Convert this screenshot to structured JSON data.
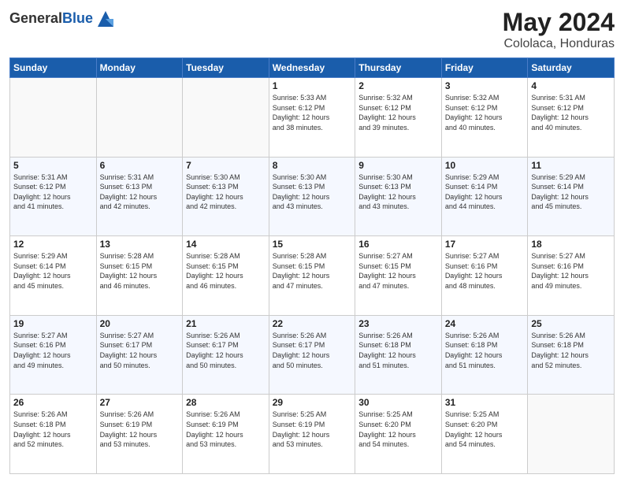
{
  "header": {
    "logo_general": "General",
    "logo_blue": "Blue",
    "month": "May 2024",
    "location": "Cololaca, Honduras"
  },
  "weekdays": [
    "Sunday",
    "Monday",
    "Tuesday",
    "Wednesday",
    "Thursday",
    "Friday",
    "Saturday"
  ],
  "weeks": [
    [
      {
        "day": "",
        "info": ""
      },
      {
        "day": "",
        "info": ""
      },
      {
        "day": "",
        "info": ""
      },
      {
        "day": "1",
        "info": "Sunrise: 5:33 AM\nSunset: 6:12 PM\nDaylight: 12 hours\nand 38 minutes."
      },
      {
        "day": "2",
        "info": "Sunrise: 5:32 AM\nSunset: 6:12 PM\nDaylight: 12 hours\nand 39 minutes."
      },
      {
        "day": "3",
        "info": "Sunrise: 5:32 AM\nSunset: 6:12 PM\nDaylight: 12 hours\nand 40 minutes."
      },
      {
        "day": "4",
        "info": "Sunrise: 5:31 AM\nSunset: 6:12 PM\nDaylight: 12 hours\nand 40 minutes."
      }
    ],
    [
      {
        "day": "5",
        "info": "Sunrise: 5:31 AM\nSunset: 6:12 PM\nDaylight: 12 hours\nand 41 minutes."
      },
      {
        "day": "6",
        "info": "Sunrise: 5:31 AM\nSunset: 6:13 PM\nDaylight: 12 hours\nand 42 minutes."
      },
      {
        "day": "7",
        "info": "Sunrise: 5:30 AM\nSunset: 6:13 PM\nDaylight: 12 hours\nand 42 minutes."
      },
      {
        "day": "8",
        "info": "Sunrise: 5:30 AM\nSunset: 6:13 PM\nDaylight: 12 hours\nand 43 minutes."
      },
      {
        "day": "9",
        "info": "Sunrise: 5:30 AM\nSunset: 6:13 PM\nDaylight: 12 hours\nand 43 minutes."
      },
      {
        "day": "10",
        "info": "Sunrise: 5:29 AM\nSunset: 6:14 PM\nDaylight: 12 hours\nand 44 minutes."
      },
      {
        "day": "11",
        "info": "Sunrise: 5:29 AM\nSunset: 6:14 PM\nDaylight: 12 hours\nand 45 minutes."
      }
    ],
    [
      {
        "day": "12",
        "info": "Sunrise: 5:29 AM\nSunset: 6:14 PM\nDaylight: 12 hours\nand 45 minutes."
      },
      {
        "day": "13",
        "info": "Sunrise: 5:28 AM\nSunset: 6:15 PM\nDaylight: 12 hours\nand 46 minutes."
      },
      {
        "day": "14",
        "info": "Sunrise: 5:28 AM\nSunset: 6:15 PM\nDaylight: 12 hours\nand 46 minutes."
      },
      {
        "day": "15",
        "info": "Sunrise: 5:28 AM\nSunset: 6:15 PM\nDaylight: 12 hours\nand 47 minutes."
      },
      {
        "day": "16",
        "info": "Sunrise: 5:27 AM\nSunset: 6:15 PM\nDaylight: 12 hours\nand 47 minutes."
      },
      {
        "day": "17",
        "info": "Sunrise: 5:27 AM\nSunset: 6:16 PM\nDaylight: 12 hours\nand 48 minutes."
      },
      {
        "day": "18",
        "info": "Sunrise: 5:27 AM\nSunset: 6:16 PM\nDaylight: 12 hours\nand 49 minutes."
      }
    ],
    [
      {
        "day": "19",
        "info": "Sunrise: 5:27 AM\nSunset: 6:16 PM\nDaylight: 12 hours\nand 49 minutes."
      },
      {
        "day": "20",
        "info": "Sunrise: 5:27 AM\nSunset: 6:17 PM\nDaylight: 12 hours\nand 50 minutes."
      },
      {
        "day": "21",
        "info": "Sunrise: 5:26 AM\nSunset: 6:17 PM\nDaylight: 12 hours\nand 50 minutes."
      },
      {
        "day": "22",
        "info": "Sunrise: 5:26 AM\nSunset: 6:17 PM\nDaylight: 12 hours\nand 50 minutes."
      },
      {
        "day": "23",
        "info": "Sunrise: 5:26 AM\nSunset: 6:18 PM\nDaylight: 12 hours\nand 51 minutes."
      },
      {
        "day": "24",
        "info": "Sunrise: 5:26 AM\nSunset: 6:18 PM\nDaylight: 12 hours\nand 51 minutes."
      },
      {
        "day": "25",
        "info": "Sunrise: 5:26 AM\nSunset: 6:18 PM\nDaylight: 12 hours\nand 52 minutes."
      }
    ],
    [
      {
        "day": "26",
        "info": "Sunrise: 5:26 AM\nSunset: 6:18 PM\nDaylight: 12 hours\nand 52 minutes."
      },
      {
        "day": "27",
        "info": "Sunrise: 5:26 AM\nSunset: 6:19 PM\nDaylight: 12 hours\nand 53 minutes."
      },
      {
        "day": "28",
        "info": "Sunrise: 5:26 AM\nSunset: 6:19 PM\nDaylight: 12 hours\nand 53 minutes."
      },
      {
        "day": "29",
        "info": "Sunrise: 5:25 AM\nSunset: 6:19 PM\nDaylight: 12 hours\nand 53 minutes."
      },
      {
        "day": "30",
        "info": "Sunrise: 5:25 AM\nSunset: 6:20 PM\nDaylight: 12 hours\nand 54 minutes."
      },
      {
        "day": "31",
        "info": "Sunrise: 5:25 AM\nSunset: 6:20 PM\nDaylight: 12 hours\nand 54 minutes."
      },
      {
        "day": "",
        "info": ""
      }
    ]
  ]
}
